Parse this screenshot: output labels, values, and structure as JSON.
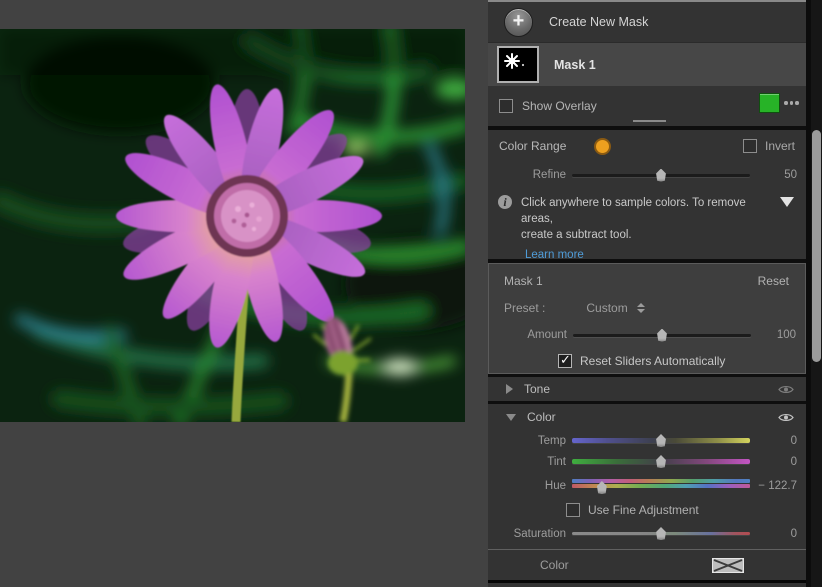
{
  "masks_panel": {
    "create_new_mask_label": "Create New Mask",
    "mask_item": {
      "label": "Mask 1"
    },
    "show_overlay": {
      "label": "Show Overlay",
      "checked": false,
      "overlay_color": "#27b327"
    }
  },
  "color_range": {
    "title": "Color Range",
    "sample_dot_color": "#eda01f",
    "invert_label": "Invert",
    "refine": {
      "label": "Refine",
      "value": "50"
    },
    "hint_line1": "Click anywhere to sample colors. To remove areas,",
    "hint_line2": "create a subtract tool.",
    "learn_more_label": "Learn more",
    "link_color": "#4f9cd8"
  },
  "mask_settings": {
    "title": "Mask 1",
    "reset_label": "Reset",
    "preset_label": "Preset :",
    "preset_value": "Custom",
    "amount": {
      "label": "Amount",
      "value": "100"
    },
    "reset_sliders": {
      "label": "Reset Sliders Automatically",
      "checked": true
    }
  },
  "tone_section": {
    "title": "Tone"
  },
  "color_section": {
    "title": "Color",
    "sliders": [
      {
        "label": "Temp",
        "value": "0"
      },
      {
        "label": "Tint",
        "value": "0"
      },
      {
        "label": "Hue",
        "value": "− 122.7"
      },
      {
        "label": "Saturation",
        "value": "0"
      }
    ],
    "use_fine_adjustment": {
      "label": "Use Fine Adjustment",
      "checked": false
    },
    "color_row_label": "Color"
  }
}
